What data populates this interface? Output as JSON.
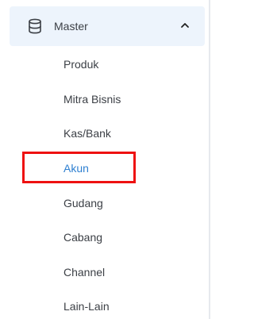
{
  "colors": {
    "header_bg": "#edf4fc",
    "text": "#3b3f45",
    "active_text": "#2f80d1",
    "highlight_border": "#ee1111"
  },
  "group": {
    "label": "Master",
    "icon": "database-icon",
    "toggle_icon": "chevron-up-icon",
    "expanded": true
  },
  "menu": {
    "items": [
      {
        "label": "Produk",
        "active": false
      },
      {
        "label": "Mitra Bisnis",
        "active": false
      },
      {
        "label": "Kas/Bank",
        "active": false
      },
      {
        "label": "Akun",
        "active": true
      },
      {
        "label": "Gudang",
        "active": false
      },
      {
        "label": "Cabang",
        "active": false
      },
      {
        "label": "Channel",
        "active": false
      },
      {
        "label": "Lain-Lain",
        "active": false
      }
    ]
  }
}
